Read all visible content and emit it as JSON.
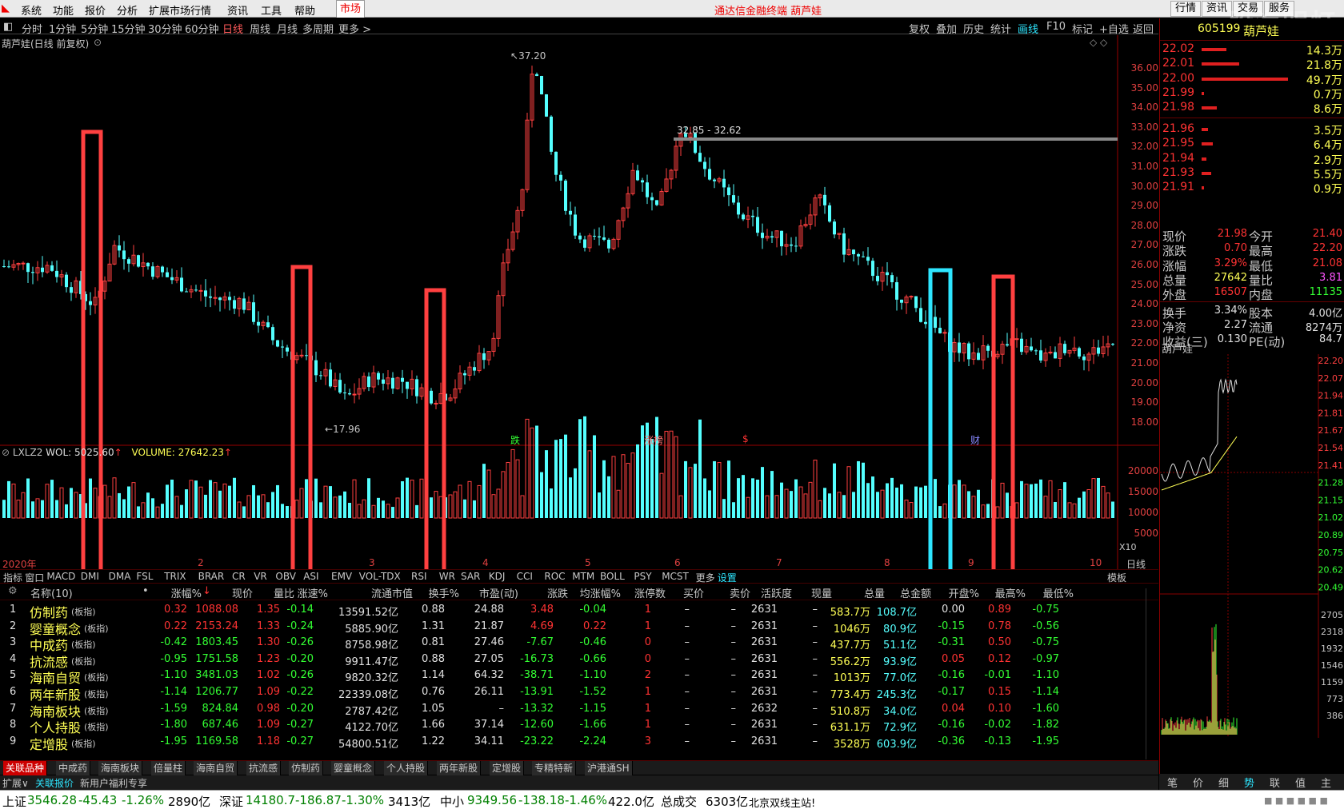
{
  "menubar": {
    "items": [
      "系统",
      "功能",
      "报价",
      "分析",
      "扩展市场行情",
      "资讯",
      "工具",
      "帮助"
    ],
    "market": "市场",
    "center_title": "通达信金融终端  葫芦娃",
    "right_buttons": [
      "行情",
      "资讯",
      "交易",
      "服务"
    ],
    "watermark": "股海明灯"
  },
  "toolbar": {
    "periods": [
      "分时",
      "1分钟",
      "5分钟",
      "15分钟",
      "30分钟",
      "60分钟",
      "日线",
      "周线",
      "月线",
      "多周期",
      "更多 >"
    ],
    "active": "日线",
    "right": [
      "复权",
      "叠加",
      "历史",
      "统计",
      "画线",
      "F10",
      "标记",
      "+自选",
      "返回"
    ]
  },
  "chart": {
    "title": "葫芦娃(日线 前复权)",
    "high_label": "37.20",
    "low_label": "17.96",
    "line_label": "32.85 - 32.62",
    "price_ticks": [
      "36.00",
      "35.00",
      "34.00",
      "33.00",
      "32.00",
      "31.00",
      "30.00",
      "29.00",
      "28.00",
      "27.00",
      "26.00",
      "25.00",
      "24.00",
      "23.00",
      "22.00",
      "21.00",
      "20.00",
      "19.00",
      "18.00"
    ],
    "markers": [
      "跌",
      "涨榜",
      "$",
      "财"
    ],
    "volume_info": {
      "name": "LXLZ2",
      "wol": "WOL: 5025.60",
      "volume": "VOLUME: 27642.23"
    },
    "volume_ticks": [
      "20000",
      "15000",
      "10000",
      "5000",
      "X10"
    ],
    "year": "2020年",
    "months": [
      "2",
      "3",
      "4",
      "5",
      "6",
      "7",
      "8",
      "9",
      "10"
    ],
    "period_label": "日线"
  },
  "indicators": {
    "tabs": [
      "指标",
      "窗口",
      "MACD",
      "DMI",
      "DMA",
      "FSL",
      "TRIX",
      "BRAR",
      "CR",
      "VR",
      "OBV",
      "ASI",
      "EMV",
      "VOL-TDX",
      "RSI",
      "WR",
      "SAR",
      "KDJ",
      "CCI",
      "ROC",
      "MTM",
      "BOLL",
      "PSY",
      "MCST",
      "更多",
      "设置"
    ],
    "selected": "设置",
    "right": "模板"
  },
  "table": {
    "headers": [
      "名称(10)",
      "•",
      "涨幅%",
      "现价",
      "量比",
      "涨速%",
      "流通市值",
      "换手%",
      "市盈(动)",
      "涨跌",
      "均涨幅%",
      "涨停数",
      "买价",
      "卖价",
      "活跃度",
      "现量",
      "总量",
      "总金额",
      "开盘%",
      "最高%",
      "最低%"
    ],
    "rows": [
      {
        "idx": "1",
        "name": "仿制药",
        "sub": "(板指)",
        "chg": "0.32",
        "price": "1088.08",
        "vr": "1.35",
        "speed": "-0.14",
        "cap": "13591.52亿",
        "turn": "0.88",
        "pe": "24.88",
        "diff": "3.48",
        "avg": "-0.04",
        "limit": "1",
        "buy": "–",
        "sell": "–",
        "act": "2631",
        "cur": "–",
        "vol": "583.7万",
        "amt": "108.7亿",
        "open": "0.00",
        "high": "0.89",
        "low": "-0.75"
      },
      {
        "idx": "2",
        "name": "婴童概念",
        "sub": "(板指)",
        "chg": "0.22",
        "price": "2153.24",
        "vr": "1.33",
        "speed": "-0.24",
        "cap": "5885.90亿",
        "turn": "1.31",
        "pe": "21.87",
        "diff": "4.69",
        "avg": "0.22",
        "limit": "1",
        "buy": "–",
        "sell": "–",
        "act": "2631",
        "cur": "–",
        "vol": "1046万",
        "amt": "80.9亿",
        "open": "-0.15",
        "high": "0.78",
        "low": "-0.56"
      },
      {
        "idx": "3",
        "name": "中成药",
        "sub": "(板指)",
        "chg": "-0.42",
        "price": "1803.45",
        "vr": "1.30",
        "speed": "-0.26",
        "cap": "8758.98亿",
        "turn": "0.81",
        "pe": "27.46",
        "diff": "-7.67",
        "avg": "-0.46",
        "limit": "0",
        "buy": "–",
        "sell": "–",
        "act": "2631",
        "cur": "–",
        "vol": "437.7万",
        "amt": "51.1亿",
        "open": "-0.31",
        "high": "0.50",
        "low": "-0.75"
      },
      {
        "idx": "4",
        "name": "抗流感",
        "sub": "(板指)",
        "chg": "-0.95",
        "price": "1751.58",
        "vr": "1.23",
        "speed": "-0.20",
        "cap": "9911.47亿",
        "turn": "0.88",
        "pe": "27.05",
        "diff": "-16.73",
        "avg": "-0.66",
        "limit": "0",
        "buy": "–",
        "sell": "–",
        "act": "2631",
        "cur": "–",
        "vol": "556.2万",
        "amt": "93.9亿",
        "open": "0.05",
        "high": "0.12",
        "low": "-0.97"
      },
      {
        "idx": "5",
        "name": "海南自贸",
        "sub": "(板指)",
        "chg": "-1.10",
        "price": "3481.03",
        "vr": "1.02",
        "speed": "-0.26",
        "cap": "9820.32亿",
        "turn": "1.14",
        "pe": "64.32",
        "diff": "-38.71",
        "avg": "-1.10",
        "limit": "2",
        "buy": "–",
        "sell": "–",
        "act": "2631",
        "cur": "–",
        "vol": "1013万",
        "amt": "77.0亿",
        "open": "-0.16",
        "high": "-0.01",
        "low": "-1.10"
      },
      {
        "idx": "6",
        "name": "两年新股",
        "sub": "(板指)",
        "chg": "-1.14",
        "price": "1206.77",
        "vr": "1.09",
        "speed": "-0.22",
        "cap": "22339.08亿",
        "turn": "0.76",
        "pe": "26.11",
        "diff": "-13.91",
        "avg": "-1.52",
        "limit": "1",
        "buy": "–",
        "sell": "–",
        "act": "2631",
        "cur": "–",
        "vol": "773.4万",
        "amt": "245.3亿",
        "open": "-0.17",
        "high": "0.15",
        "low": "-1.14"
      },
      {
        "idx": "7",
        "name": "海南板块",
        "sub": "(板指)",
        "chg": "-1.59",
        "price": "824.84",
        "vr": "0.98",
        "speed": "-0.20",
        "cap": "2787.42亿",
        "turn": "1.05",
        "pe": "–",
        "diff": "-13.32",
        "avg": "-1.15",
        "limit": "1",
        "buy": "–",
        "sell": "–",
        "act": "2632",
        "cur": "–",
        "vol": "510.8万",
        "amt": "34.0亿",
        "open": "0.04",
        "high": "0.10",
        "low": "-1.60"
      },
      {
        "idx": "8",
        "name": "个人持股",
        "sub": "(板指)",
        "chg": "-1.80",
        "price": "687.46",
        "vr": "1.09",
        "speed": "-0.27",
        "cap": "4122.70亿",
        "turn": "1.66",
        "pe": "37.14",
        "diff": "-12.60",
        "avg": "-1.66",
        "limit": "1",
        "buy": "–",
        "sell": "–",
        "act": "2631",
        "cur": "–",
        "vol": "631.1万",
        "amt": "72.9亿",
        "open": "-0.16",
        "high": "-0.02",
        "low": "-1.82"
      },
      {
        "idx": "9",
        "name": "定增股",
        "sub": "(板指)",
        "chg": "-1.95",
        "price": "1169.58",
        "vr": "1.18",
        "speed": "-0.27",
        "cap": "54800.51亿",
        "turn": "1.22",
        "pe": "34.11",
        "diff": "-23.22",
        "avg": "-2.24",
        "limit": "3",
        "buy": "–",
        "sell": "–",
        "act": "2631",
        "cur": "–",
        "vol": "3528万",
        "amt": "603.9亿",
        "open": "-0.36",
        "high": "-0.13",
        "low": "-1.95"
      }
    ]
  },
  "sector_tabs": [
    "关联品种",
    "中成药",
    "海南板块",
    "倍量柱",
    "海南自贸",
    "抗流感",
    "仿制药",
    "婴童概念",
    "个人持股",
    "两年新股",
    "定增股",
    "专精特新",
    "沪港通SH"
  ],
  "row2": [
    "扩展∨",
    "关联报价",
    "新用户福利专享"
  ],
  "status": {
    "sh_label": "上证",
    "sh_val": "3546.28",
    "sh_chg": "-45.43",
    "sh_pct": "-1.26%",
    "sh_amt": "2890亿",
    "sz_label": "深证",
    "sz_val": "14180.7",
    "sz_chg": "-186.87",
    "sz_pct": "-1.30%",
    "sz_amt": "3413亿",
    "zx_label": "中小",
    "zx_val": "9349.56",
    "zx_chg": "-138.18",
    "zx_pct": "-1.46%",
    "zx_amt": "422.0亿",
    "total_label": "总成交",
    "total_val": "6303亿",
    "server": "北京双线主站!"
  },
  "quote": {
    "code": "605199",
    "name": "葫芦娃",
    "asks": [
      {
        "p": "22.02",
        "v": "14.3万"
      },
      {
        "p": "22.01",
        "v": "21.8万"
      },
      {
        "p": "22.00",
        "v": "49.7万"
      },
      {
        "p": "21.99",
        "v": "0.7万"
      },
      {
        "p": "21.98",
        "v": "8.6万"
      }
    ],
    "bids": [
      {
        "p": "21.96",
        "v": "3.5万"
      },
      {
        "p": "21.95",
        "v": "6.4万"
      },
      {
        "p": "21.94",
        "v": "2.9万"
      },
      {
        "p": "21.93",
        "v": "5.5万"
      },
      {
        "p": "21.91",
        "v": "0.9万"
      }
    ],
    "stats": [
      {
        "l1": "现价",
        "v1": "21.98",
        "l2": "今开",
        "v2": "21.40"
      },
      {
        "l1": "涨跌",
        "v1": "0.70",
        "l2": "最高",
        "v2": "22.20"
      },
      {
        "l1": "涨幅",
        "v1": "3.29%",
        "l2": "最低",
        "v2": "21.08"
      },
      {
        "l1": "总量",
        "v1": "27642",
        "l2": "量比",
        "v2": "3.81"
      },
      {
        "l1": "外盘",
        "v1": "16507",
        "l2": "内盘",
        "v2": "11135"
      },
      {
        "l1": "换手",
        "v1": "3.34%",
        "l2": "股本",
        "v2": "4.00亿"
      },
      {
        "l1": "净资",
        "v1": "2.27",
        "l2": "流通",
        "v2": "8274万"
      },
      {
        "l1": "收益(三)",
        "v1": "0.130",
        "l2": "PE(动)",
        "v2": "84.7"
      }
    ],
    "mini_title": "葫芦娃",
    "mini_ticks": [
      "22.20",
      "22.07",
      "21.94",
      "21.81",
      "21.67",
      "21.54",
      "21.41",
      "21.28",
      "21.15",
      "21.02",
      "20.89",
      "20.75",
      "20.62",
      "20.49",
      "2705",
      "2318",
      "1932",
      "1546",
      "1159",
      "773",
      "386"
    ],
    "mini_tabs": [
      "笔",
      "价",
      "细",
      "势",
      "联",
      "值",
      "主"
    ],
    "mini_sel": "势"
  }
}
